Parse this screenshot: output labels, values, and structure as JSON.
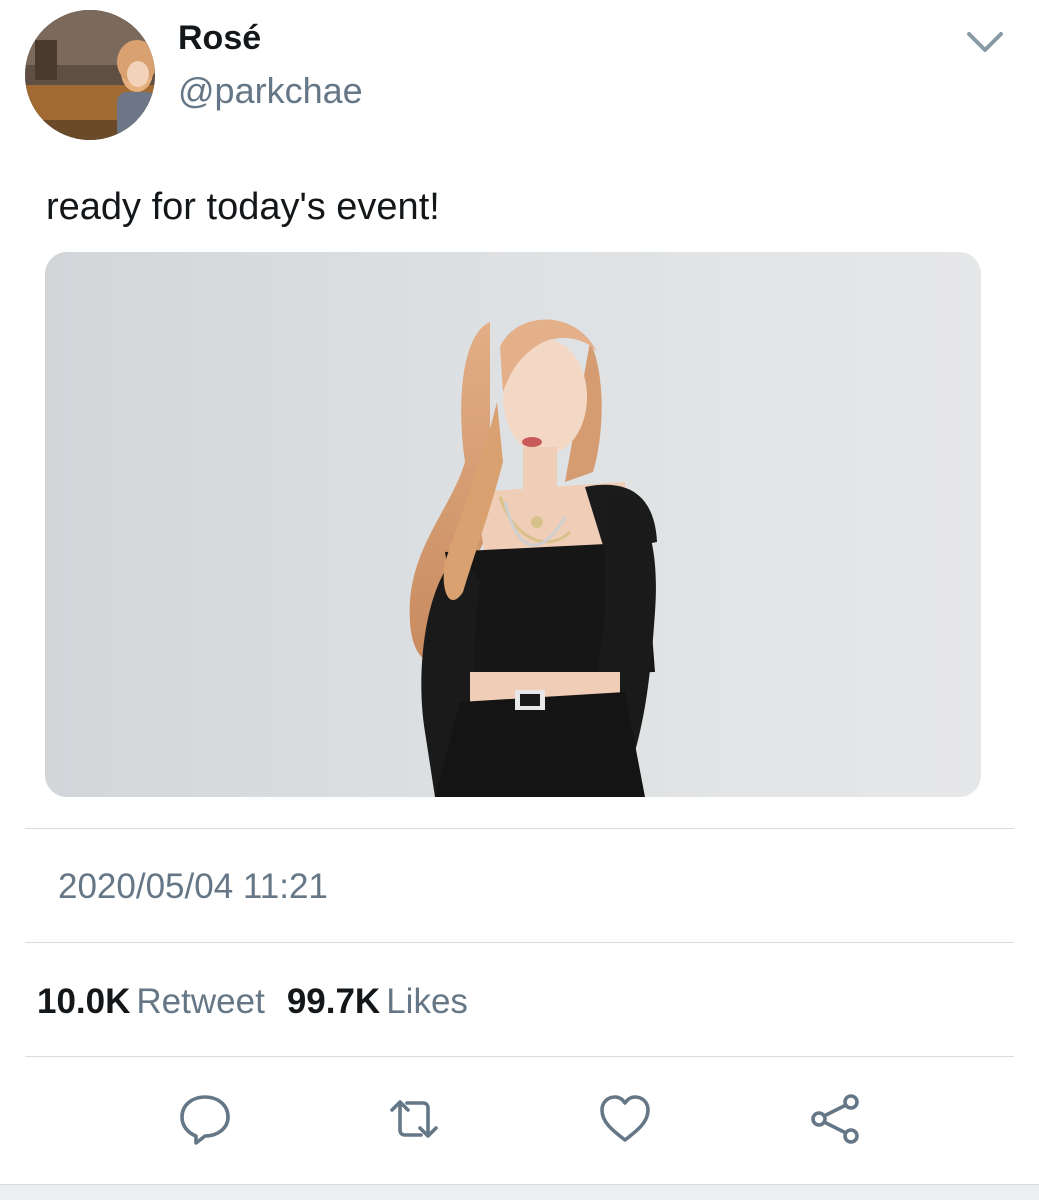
{
  "tweet": {
    "display_name": "Rosé",
    "handle": "@parkchae",
    "text": "ready for today's event!",
    "timestamp": "2020/05/04 11:21"
  },
  "stats": {
    "retweet_count": "10.0K",
    "retweet_label": "Retweet",
    "like_count": "99.7K",
    "like_label": "Likes"
  },
  "icons": {
    "more": "chevron-down-icon",
    "reply": "reply-icon",
    "retweet": "retweet-icon",
    "like": "heart-icon",
    "share": "share-icon"
  },
  "colors": {
    "primary_text": "#14171a",
    "secondary_text": "#657786",
    "icon": "#657786",
    "divider": "#d6dbe0"
  }
}
